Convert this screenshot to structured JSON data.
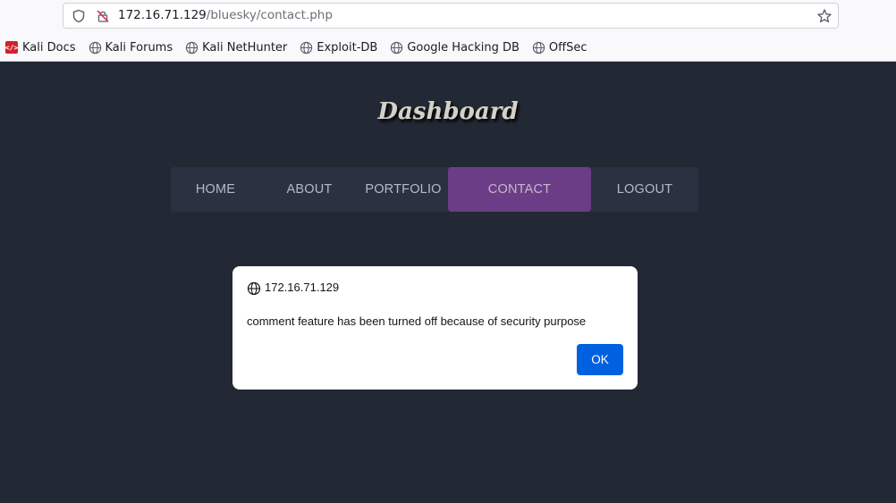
{
  "browser": {
    "url_host": "172.16.71.129",
    "url_path": "/bluesky/contact.php",
    "bookmarks": [
      {
        "label": "Kali Docs",
        "icon": "kali-docs-icon"
      },
      {
        "label": "Kali Forums",
        "icon": "globe-icon"
      },
      {
        "label": "Kali NetHunter",
        "icon": "globe-icon"
      },
      {
        "label": "Exploit-DB",
        "icon": "globe-icon"
      },
      {
        "label": "Google Hacking DB",
        "icon": "globe-icon"
      },
      {
        "label": "OffSec",
        "icon": "globe-icon"
      }
    ]
  },
  "page": {
    "title": "Dashboard",
    "nav": [
      {
        "label": "HOME"
      },
      {
        "label": "ABOUT"
      },
      {
        "label": "PORTFOLIO"
      },
      {
        "label": "CONTACT",
        "active": true
      },
      {
        "label": "LOGOUT"
      }
    ]
  },
  "dialog": {
    "host": "172.16.71.129",
    "message": "comment feature has been turned off because of security purpose",
    "ok_label": "OK"
  },
  "colors": {
    "page_background": "#222834",
    "nav_background": "#2a3140",
    "nav_active": "#6b3d86",
    "ok_button": "#0061e0"
  }
}
